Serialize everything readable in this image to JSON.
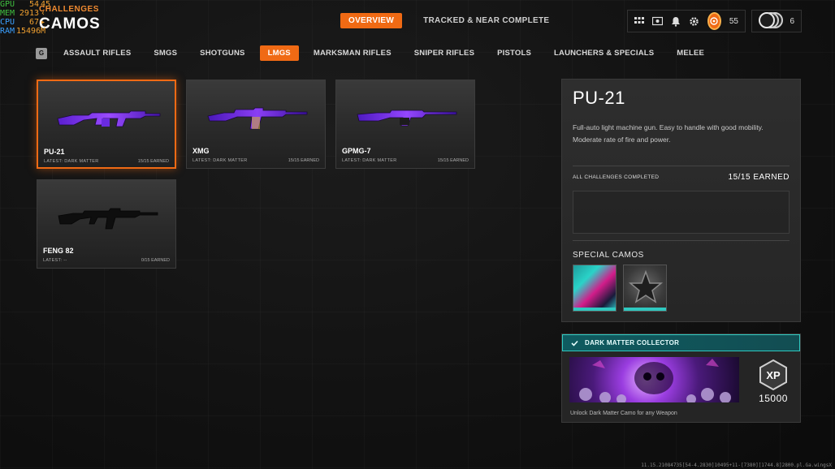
{
  "perf": [
    {
      "key": "GPU",
      "value": "54",
      "unit": "45"
    },
    {
      "key": "MEM",
      "value": "2913",
      "unit": "‹"
    },
    {
      "key": "CPU",
      "value": "67",
      "unit": "▸"
    },
    {
      "key": "RAM",
      "value": "15496",
      "unit": "M"
    }
  ],
  "header": {
    "subtitle": "CHALLENGES",
    "title": "CAMOS"
  },
  "topnav": {
    "tabs": [
      {
        "label": "OVERVIEW",
        "active": true
      },
      {
        "label": "TRACKED & NEAR COMPLETE",
        "active": false
      }
    ]
  },
  "toolbar": {
    "icons": [
      "grid-icon",
      "inventory-icon",
      "bell-icon",
      "gear-icon"
    ],
    "level": "55",
    "prestige_count": "6"
  },
  "categories": {
    "key_hint": "G",
    "tabs": [
      {
        "label": "ASSAULT RIFLES",
        "active": false
      },
      {
        "label": "SMGS",
        "active": false
      },
      {
        "label": "SHOTGUNS",
        "active": false
      },
      {
        "label": "LMGS",
        "active": true
      },
      {
        "label": "MARKSMAN RIFLES",
        "active": false
      },
      {
        "label": "SNIPER RIFLES",
        "active": false
      },
      {
        "label": "PISTOLS",
        "active": false
      },
      {
        "label": "LAUNCHERS & SPECIALS",
        "active": false
      },
      {
        "label": "MELEE",
        "active": false
      }
    ]
  },
  "weapons": [
    {
      "name": "PU-21",
      "latest": "LATEST: DARK MATTER",
      "earned": "15/15 EARNED",
      "camo": "dark-matter",
      "selected": true
    },
    {
      "name": "XMG",
      "latest": "LATEST: DARK MATTER",
      "earned": "15/15 EARNED",
      "camo": "dark-matter",
      "selected": false
    },
    {
      "name": "GPMG-7",
      "latest": "LATEST: DARK MATTER",
      "earned": "15/15 EARNED",
      "camo": "dark-matter",
      "selected": false
    },
    {
      "name": "FENG 82",
      "latest": "LATEST: --",
      "earned": "0/15 EARNED",
      "camo": "none",
      "selected": false
    }
  ],
  "detail": {
    "name": "PU-21",
    "description": "Full-auto light machine gun.  Easy to handle with good mobility. Moderate rate of fire and power.",
    "challenges_label": "ALL CHALLENGES COMPLETED",
    "challenges_value": "15/15 EARNED",
    "special_camos_label": "SPECIAL CAMOS"
  },
  "challenge": {
    "title": "DARK MATTER COLLECTOR",
    "xp": "15000",
    "xp_badge": "XP",
    "unlock_text": "Unlock Dark Matter Camo for any Weapon"
  },
  "build_string": "11.15.21084735[54-4.2830]10495+11-[7380][1744.8]2800.pl.Ga.wingsX"
}
